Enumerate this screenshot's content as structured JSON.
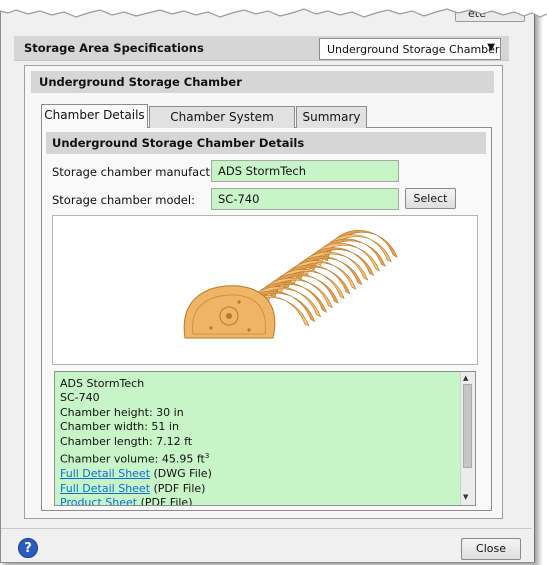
{
  "top_partial_button": "ete",
  "specs": {
    "title": "Storage Area Specifications",
    "type_selected": "Underground Storage Chamber"
  },
  "panel": {
    "title": "Underground Storage Chamber"
  },
  "tabs": [
    {
      "label": "Chamber Details",
      "active": true
    },
    {
      "label": "Chamber System Design",
      "active": false
    },
    {
      "label": "Summary",
      "active": false
    }
  ],
  "details": {
    "title": "Underground Storage Chamber Details",
    "manufacturer_label": "Storage chamber manufacturer:",
    "manufacturer_value": "ADS StormTech",
    "model_label": "Storage chamber model:",
    "model_value": "SC-740",
    "select_label": "Select"
  },
  "info": {
    "manufacturer": "ADS StormTech",
    "model": "SC-740",
    "height": "Chamber height: 30 in",
    "width": "Chamber width: 51 in",
    "length": "Chamber length: 7.12 ft",
    "volume": "Chamber volume: 45.95 ft",
    "volume_sup": "3",
    "link1_text": "Full Detail Sheet",
    "link1_suffix": " (DWG File)",
    "link2_text": "Full Detail Sheet",
    "link2_suffix": " (PDF File)",
    "link3_text": "Product Sheet",
    "link3_suffix": " (PDF File)"
  },
  "footer": {
    "help_glyph": "?",
    "close_label": "Close"
  },
  "colors": {
    "green_field": "#c8f5c8",
    "chamber_orange": "#e8a85a",
    "link_blue": "#0a6fd6",
    "help_blue": "#2a5bc0"
  }
}
